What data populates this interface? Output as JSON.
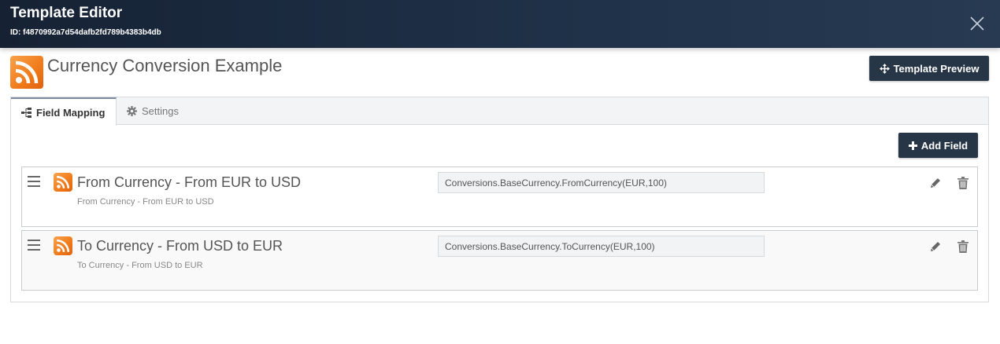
{
  "header": {
    "title": "Template Editor",
    "id_text": "ID: f4870992a7d54dafb2fd789b4383b4db"
  },
  "page": {
    "title": "Currency Conversion Example",
    "preview_button": "Template Preview",
    "icon": "rss-icon",
    "accent": "#263646"
  },
  "tabs": [
    {
      "label": "Field Mapping",
      "icon": "hierarchy-icon",
      "active": true
    },
    {
      "label": "Settings",
      "icon": "gear-icon",
      "active": false
    }
  ],
  "add_field_button": "Add Field",
  "fields": [
    {
      "name": "From Currency - From EUR to USD",
      "description": "From Currency - From EUR to USD",
      "expression": "Conversions.BaseCurrency.FromCurrency(EUR,100)"
    },
    {
      "name": "To Currency - From USD to EUR",
      "description": "To Currency - From USD to EUR",
      "expression": "Conversions.BaseCurrency.ToCurrency(EUR,100)"
    }
  ]
}
